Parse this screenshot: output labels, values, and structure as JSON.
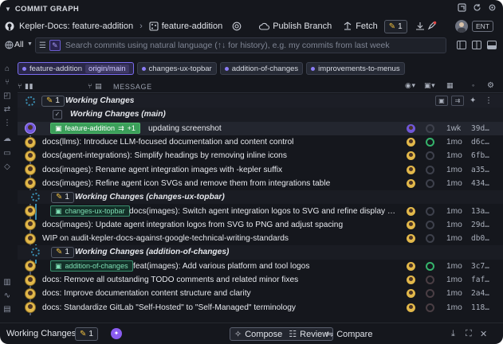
{
  "titlebar": {
    "title": "COMMIT GRAPH"
  },
  "toolbar": {
    "repo": "Kepler-Docs: feature-addition",
    "branch": "feature-addition",
    "publish": "Publish Branch",
    "fetch": "Fetch",
    "wip_count": "1",
    "account_badge": "ENT"
  },
  "search": {
    "scope": "All",
    "placeholder": "Search commits using natural language (↑↓ for history), e.g. my commits from last week"
  },
  "chips": [
    {
      "label": "feature-addition",
      "sub": "origin/main"
    },
    {
      "label": "changes-ux-topbar"
    },
    {
      "label": "addition-of-changes"
    },
    {
      "label": "improvements-to-menus"
    }
  ],
  "columns": {
    "message": "MESSAGE"
  },
  "rows": [
    {
      "type": "wc",
      "msg": "Working Changes",
      "count": "1"
    },
    {
      "type": "wc2",
      "msg": "Working Changes (main)"
    },
    {
      "type": "branch",
      "chip": "feature-addition",
      "plus": "+1",
      "msg": "updating screenshot",
      "age": "1wk",
      "sha": "39d…"
    },
    {
      "type": "commit",
      "msg": "docs(llms): Introduce LLM-focused documentation and content control",
      "age": "1mo",
      "sha": "d6c…"
    },
    {
      "type": "commit",
      "msg": "docs(agent-integrations): Simplify headings by removing inline icons",
      "age": "1mo",
      "sha": "6fb…"
    },
    {
      "type": "commit",
      "msg": "docs(images): Rename agent integration images with -kepler suffix",
      "age": "1mo",
      "sha": "a35…"
    },
    {
      "type": "commit",
      "msg": "docs(images): Refine agent icon SVGs and remove them from integrations table",
      "age": "1mo",
      "sha": "434…"
    },
    {
      "type": "wc3",
      "msg": "Working Changes (changes-ux-topbar)",
      "count": "1"
    },
    {
      "type": "bcommit",
      "chip": "changes-ux-topbar",
      "msg": "docs(images): Switch agent integration logos to SVG and refine display styles ·…",
      "age": "1mo",
      "sha": "13a…"
    },
    {
      "type": "commit",
      "msg": "docs(images): Update agent integration logos from SVG to PNG and adjust spacing",
      "age": "1mo",
      "sha": "29d…"
    },
    {
      "type": "commit",
      "msg": "WIP on audit-kepler-docs-against-google-technical-writing-standards",
      "age": "1mo",
      "sha": "db0…"
    },
    {
      "type": "wc3",
      "msg": "Working Changes (addition-of-changes)",
      "count": "1"
    },
    {
      "type": "bcommit",
      "chip": "addition-of-changes",
      "msg": "feat(images): Add various platform and tool logos",
      "age": "1mo",
      "sha": "3c7…"
    },
    {
      "type": "commit",
      "msg": "docs: Remove all outstanding TODO comments and related minor fixes",
      "age": "1mo",
      "sha": "faf…"
    },
    {
      "type": "commit",
      "msg": "docs: Improve documentation content structure and clarity",
      "age": "1mo",
      "sha": "2a4…"
    },
    {
      "type": "commit",
      "msg": "docs: Standardize GitLab \"Self-Hosted\" to \"Self-Managed\" terminology",
      "age": "1mo",
      "sha": "118…"
    }
  ],
  "footer": {
    "label": "Working Changes",
    "count": "1",
    "compose": "Compose",
    "review": "Review",
    "compare": "Compare"
  }
}
